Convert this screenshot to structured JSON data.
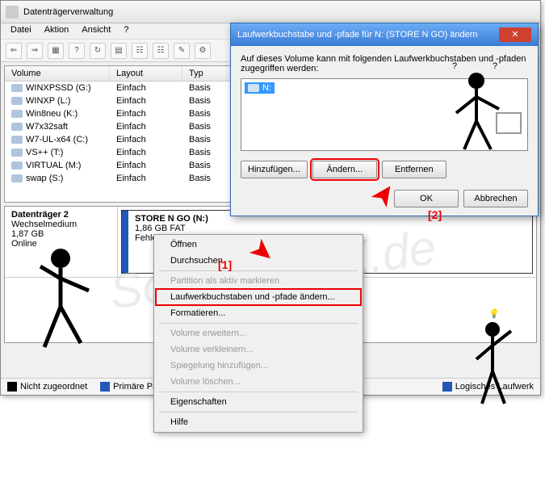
{
  "window": {
    "title": "Datenträgerverwaltung"
  },
  "menu": {
    "file": "Datei",
    "action": "Aktion",
    "view": "Ansicht",
    "help": "?"
  },
  "volumes": {
    "headers": {
      "volume": "Volume",
      "layout": "Layout",
      "type": "Typ"
    },
    "rows": [
      {
        "name": "WINXPSSD (G:)",
        "layout": "Einfach",
        "type": "Basis"
      },
      {
        "name": "WINXP (L:)",
        "layout": "Einfach",
        "type": "Basis"
      },
      {
        "name": "Win8neu (K:)",
        "layout": "Einfach",
        "type": "Basis"
      },
      {
        "name": "W7x32saft",
        "layout": "Einfach",
        "type": "Basis"
      },
      {
        "name": "W7-UL-x64 (C:)",
        "layout": "Einfach",
        "type": "Basis"
      },
      {
        "name": "VS++ (T:)",
        "layout": "Einfach",
        "type": "Basis"
      },
      {
        "name": "VIRTUAL (M:)",
        "layout": "Einfach",
        "type": "Basis"
      },
      {
        "name": "swap (S:)",
        "layout": "Einfach",
        "type": "Basis"
      }
    ]
  },
  "disk": {
    "name": "Datenträger 2",
    "kind": "Wechselmedium",
    "size": "1,87 GB",
    "status": "Online",
    "part_name": "STORE N GO  (N:)",
    "part_info": "1,86 GB FAT",
    "part_status": "Fehlerfrei"
  },
  "legend": {
    "unalloc": "Nicht zugeordnet",
    "primary": "Primäre Partition",
    "logical": "Logisches Laufwerk"
  },
  "dialog": {
    "title": "Laufwerkbuchstabe und -pfade für N: (STORE N GO) ändern",
    "msg": "Auf dieses Volume kann mit folgenden Laufwerkbuchstaben und -pfaden zugegriffen werden:",
    "item": "N:",
    "add": "Hinzufügen...",
    "change": "Ändern...",
    "remove": "Entfernen",
    "ok": "OK",
    "cancel": "Abbrechen"
  },
  "ctx": {
    "open": "Öffnen",
    "explore": "Durchsuchen",
    "markactive": "Partition als aktiv markieren",
    "changeletter": "Laufwerkbuchstaben und -pfade ändern...",
    "format": "Formatieren...",
    "extend": "Volume erweitern...",
    "shrink": "Volume verkleinern...",
    "mirror": "Spiegelung hinzufügen...",
    "delete": "Volume löschen...",
    "props": "Eigenschaften",
    "help": "Hilfe"
  },
  "annot": {
    "one": "[1]",
    "two": "[2]"
  },
  "watermark": "SoftwareOK.de"
}
